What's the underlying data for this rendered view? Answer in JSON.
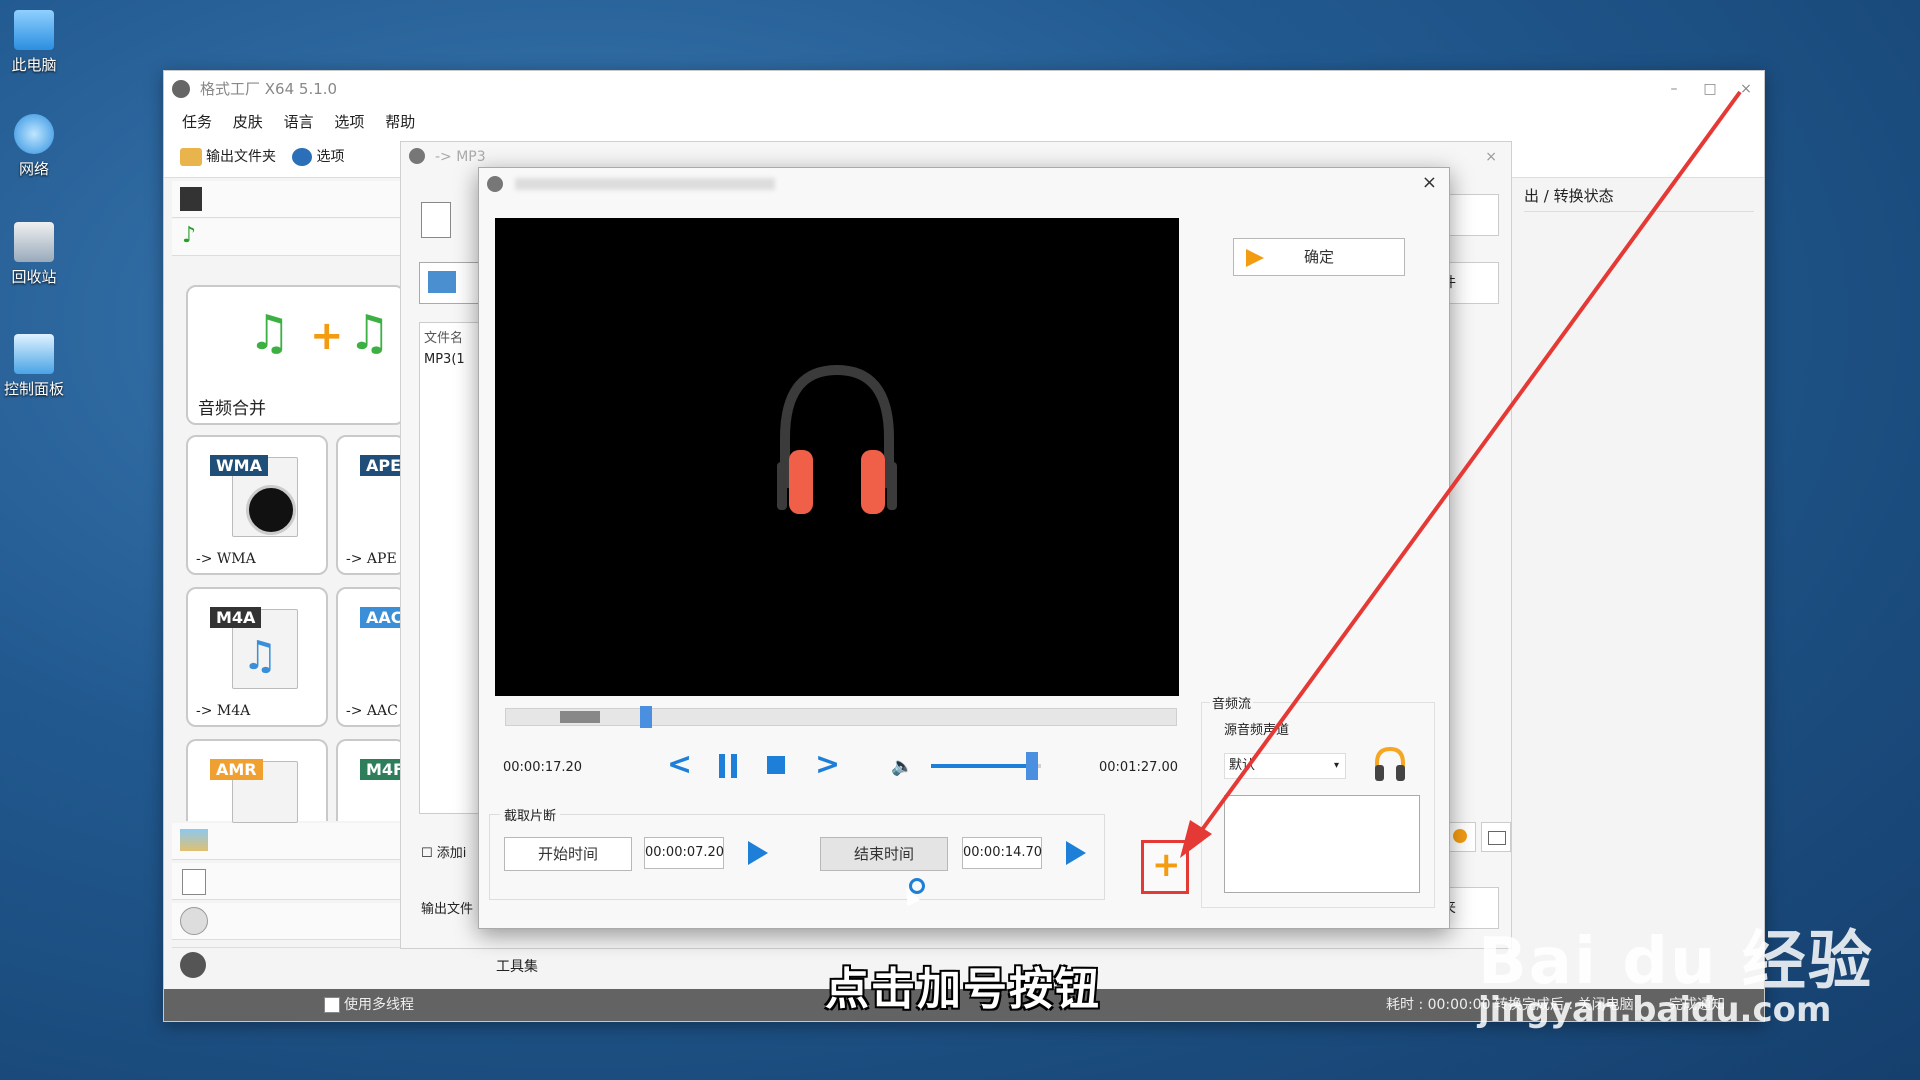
{
  "desktop": {
    "icons": [
      {
        "label": "此电脑"
      },
      {
        "label": "网络"
      },
      {
        "label": "回收站"
      },
      {
        "label": "控制面板"
      }
    ]
  },
  "app": {
    "title": "格式工厂 X64 5.1.0",
    "menu": [
      "任务",
      "皮肤",
      "语言",
      "选项",
      "帮助"
    ],
    "toolbar": {
      "output_folder": "输出文件夹",
      "options": "选项"
    },
    "tiles": {
      "merge": "音频合并",
      "wma_badge": "WMA",
      "wma_label": "-> WMA",
      "ape_badge": "APE",
      "ape_label": "-> APE",
      "m4a_badge": "M4A",
      "m4a_label": "-> M4A",
      "aac_badge": "AAC",
      "aac_label": "-> AAC",
      "amr_badge": "AMR",
      "m4r_badge": "M4F"
    },
    "toolset": "工具集",
    "right_header": "出 / 转换状态",
    "right_btn": "件",
    "right_btn2": "夹",
    "statusbar": {
      "multithread": "使用多线程",
      "elapsed": "耗时 : 00:00:00",
      "after": "转换完成后 : 关闭电脑",
      "notify": "完成通知"
    }
  },
  "convert_dialog": {
    "title": "-> MP3",
    "filename_header": "文件名",
    "file": "MP3(1",
    "add_checkbox": "添加i",
    "output_label": "输出文件"
  },
  "clip_dialog": {
    "close": "×",
    "ok": "确定",
    "time_current": "00:00:17.20",
    "time_total": "00:01:27.00",
    "clip_group": "截取片断",
    "start_btn": "开始时间",
    "start_value": "00:00:07.20",
    "end_btn": "结束时间",
    "end_value": "00:00:14.70",
    "audio_stream": "音频流",
    "source_channel": "源音频声道",
    "channel_select": "默认",
    "seek_progress": 0.2,
    "volume_level": 0.92
  },
  "overlay": {
    "caption": "点击加号按钮",
    "watermark_brand": "Bai du 经验",
    "watermark_url": "jingyan.baidu.com"
  },
  "colors": {
    "accent": "#1e7fd8",
    "highlight": "#e53935",
    "plus": "#f39c12"
  }
}
